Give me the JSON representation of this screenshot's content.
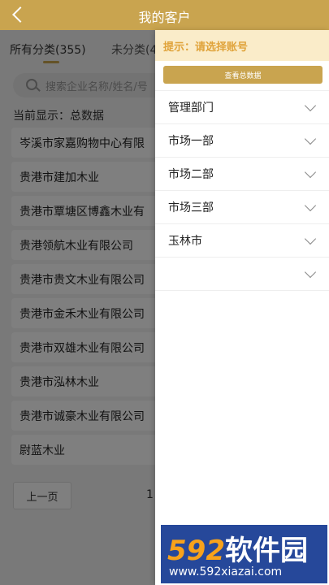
{
  "header": {
    "title": "我的客户"
  },
  "tabs": [
    {
      "label": "所有分类(355)"
    },
    {
      "label": "未分类(4"
    }
  ],
  "search": {
    "placeholder": "搜索企业名称/姓名/号"
  },
  "current_display": "当前显示：总数据",
  "customers": [
    "岑溪市家嘉购物中心有限",
    "贵港市建加木业",
    "贵港市覃塘区博鑫木业有",
    "贵港领航木业有限公司",
    "贵港市贵文木业有限公司",
    "贵港市金禾木业有限公司",
    "贵港市双雄木业有限公司",
    "贵港市泓林木业",
    "贵港市诚豪木业有限公司",
    "尉蓝木业"
  ],
  "pager": {
    "prev_label": "上一页",
    "current": "1"
  },
  "drawer": {
    "hint": "提示：请选择账号",
    "view_all": "查看总数据",
    "departments": [
      "管理部门",
      "市场一部",
      "市场二部",
      "市场三部",
      "玉林市",
      ""
    ]
  },
  "watermark": {
    "brand_num": "592",
    "brand_text": "软件园",
    "url": "www.592xiazai.com"
  }
}
